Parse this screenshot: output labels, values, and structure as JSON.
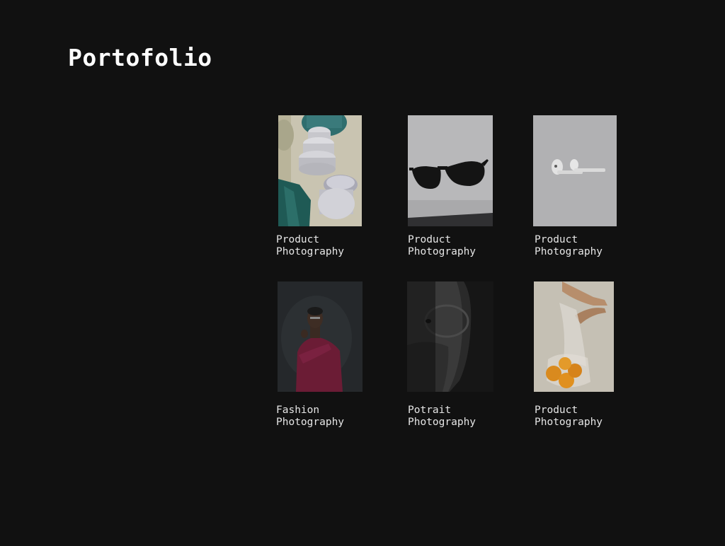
{
  "page": {
    "title": "Portofolio"
  },
  "colors": {
    "background": "#111111",
    "title": "#ffffff",
    "caption": "#e6e6e6"
  },
  "portfolio": {
    "items": [
      {
        "caption_line1": "Product",
        "caption_line2": "Photography",
        "image": "ceramic-vessels"
      },
      {
        "caption_line1": "Product",
        "caption_line2": "Photography",
        "image": "sunglasses"
      },
      {
        "caption_line1": "Product",
        "caption_line2": "Photography",
        "image": "wireless-earbuds"
      },
      {
        "caption_line1": "Fashion",
        "caption_line2": "Photography",
        "image": "man-red-sweater"
      },
      {
        "caption_line1": "Potrait",
        "caption_line2": "Photography",
        "image": "man-with-glasses"
      },
      {
        "caption_line1": "Product",
        "caption_line2": "Photography",
        "image": "oranges-in-net-bag"
      }
    ]
  }
}
